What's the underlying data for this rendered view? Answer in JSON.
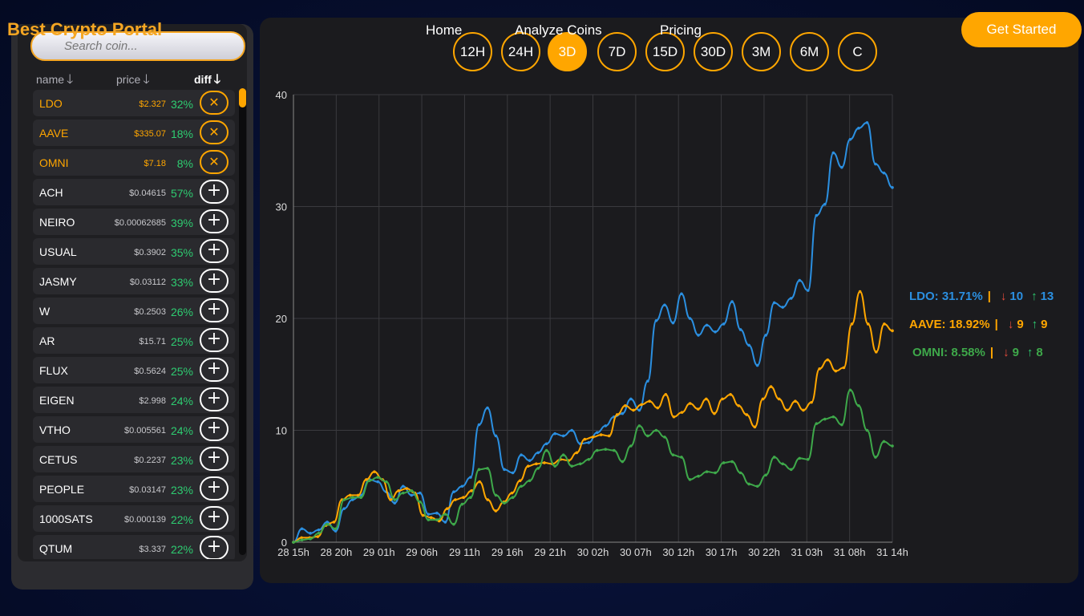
{
  "brand": "Best Crypto Portal",
  "nav": {
    "home": "Home",
    "analyze": "Analyze Coins",
    "pricing": "Pricing",
    "cta": "Get Started"
  },
  "search": {
    "placeholder": "Search coin..."
  },
  "columns": {
    "name": "name",
    "price": "price",
    "diff": "diff",
    "sort_icon": "arrow-down-icon"
  },
  "coins": [
    {
      "name": "LDO",
      "price": "$2.327",
      "diff": "32%",
      "selected": true
    },
    {
      "name": "AAVE",
      "price": "$335.07",
      "diff": "18%",
      "selected": true
    },
    {
      "name": "OMNI",
      "price": "$7.18",
      "diff": "8%",
      "selected": true
    },
    {
      "name": "ACH",
      "price": "$0.04615",
      "diff": "57%",
      "selected": false
    },
    {
      "name": "NEIRO",
      "price": "$0.00062685",
      "diff": "39%",
      "selected": false
    },
    {
      "name": "USUAL",
      "price": "$0.3902",
      "diff": "35%",
      "selected": false
    },
    {
      "name": "JASMY",
      "price": "$0.03112",
      "diff": "33%",
      "selected": false
    },
    {
      "name": "W",
      "price": "$0.2503",
      "diff": "26%",
      "selected": false
    },
    {
      "name": "AR",
      "price": "$15.71",
      "diff": "25%",
      "selected": false
    },
    {
      "name": "FLUX",
      "price": "$0.5624",
      "diff": "25%",
      "selected": false
    },
    {
      "name": "EIGEN",
      "price": "$2.998",
      "diff": "24%",
      "selected": false
    },
    {
      "name": "VTHO",
      "price": "$0.005561",
      "diff": "24%",
      "selected": false
    },
    {
      "name": "CETUS",
      "price": "$0.2237",
      "diff": "23%",
      "selected": false
    },
    {
      "name": "PEOPLE",
      "price": "$0.03147",
      "diff": "23%",
      "selected": false
    },
    {
      "name": "1000SATS",
      "price": "$0.000139",
      "diff": "22%",
      "selected": false
    },
    {
      "name": "QTUM",
      "price": "$3.337",
      "diff": "22%",
      "selected": false
    }
  ],
  "buttons": {
    "remove_icon": "close-icon",
    "remove_glyph": "✕",
    "add_icon": "plus-icon",
    "add_glyph": "+"
  },
  "timeframes": {
    "options": [
      "12H",
      "24H",
      "3D",
      "7D",
      "15D",
      "30D",
      "3M",
      "6M",
      "C"
    ],
    "active": "3D"
  },
  "chart_data": {
    "type": "line",
    "x_ticks": [
      "28 15h",
      "28 20h",
      "29 01h",
      "29 06h",
      "29 11h",
      "29 16h",
      "29 21h",
      "30 02h",
      "30 07h",
      "30 12h",
      "30 17h",
      "30 22h",
      "31 03h",
      "31 08h",
      "31 14h"
    ],
    "y_ticks": [
      0,
      10,
      20,
      30,
      40
    ],
    "ylim": [
      0,
      40
    ],
    "grid": true,
    "series": [
      {
        "name": "LDO",
        "color": "#2b8fe0",
        "values": [
          0,
          1.2,
          0.8,
          1.1,
          1.8,
          1.0,
          3.0,
          3.8,
          4.2,
          5.6,
          5.4,
          4.5,
          3.5,
          5.0,
          4.2,
          4.4,
          2.5,
          2.6,
          1.8,
          4.5,
          5.0,
          5.8,
          10.5,
          12.0,
          9.5,
          6.5,
          6.2,
          7.8,
          7.3,
          8.0,
          8.8,
          9.7,
          9.5,
          10.0,
          8.8,
          8.9,
          9.8,
          10.4,
          11.2,
          11.5,
          12.8,
          11.8,
          14.4,
          19.8,
          21.2,
          19.6,
          22.2,
          20.0,
          18.5,
          19.4,
          18.8,
          19.5,
          21.5,
          19.0,
          17.6,
          15.8,
          18.5,
          21.4,
          21.0,
          21.8,
          23.4,
          22.5,
          29.2,
          30.2,
          34.8,
          33.5,
          36.0,
          37.0,
          37.5,
          33.8,
          33.0,
          31.7
        ]
      },
      {
        "name": "AAVE",
        "color": "#ffa600",
        "values": [
          0,
          0.4,
          0.4,
          0.5,
          1.5,
          1.8,
          3.8,
          4.2,
          4.2,
          5.6,
          6.3,
          5.6,
          3.8,
          4.6,
          4.8,
          4.4,
          2.4,
          2.2,
          1.9,
          3.0,
          3.8,
          4.0,
          4.6,
          5.4,
          3.8,
          2.8,
          3.6,
          4.4,
          5.5,
          6.8,
          7.0,
          7.1,
          7.0,
          7.4,
          7.3,
          8.0,
          9.2,
          9.4,
          9.6,
          9.5,
          11.4,
          12.2,
          11.8,
          12.3,
          12.6,
          12.0,
          13.2,
          11.2,
          11.6,
          12.4,
          11.9,
          12.8,
          11.5,
          12.8,
          13.2,
          12.2,
          11.4,
          10.3,
          12.8,
          13.9,
          12.8,
          11.8,
          12.6,
          11.8,
          12.5,
          15.5,
          16.3,
          15.3,
          15.6,
          19.5,
          22.4,
          19.5,
          17.0,
          19.5,
          18.9
        ]
      },
      {
        "name": "OMNI",
        "color": "#3ea84a",
        "values": [
          0,
          0.2,
          0.3,
          0.8,
          1.6,
          1.2,
          3.8,
          4.0,
          4.0,
          5.5,
          5.8,
          5.4,
          3.8,
          4.4,
          4.6,
          3.6,
          2.0,
          2.0,
          2.5,
          1.6,
          3.4,
          4.0,
          6.5,
          6.6,
          4.2,
          3.5,
          4.0,
          5.0,
          5.5,
          6.6,
          8.2,
          6.8,
          7.8,
          6.8,
          7.0,
          7.4,
          8.2,
          8.3,
          8.2,
          7.2,
          8.6,
          10.4,
          9.5,
          10.0,
          9.4,
          7.8,
          7.6,
          5.6,
          5.9,
          6.3,
          6.2,
          7.1,
          7.2,
          6.2,
          5.2,
          5.0,
          6.0,
          7.6,
          7.0,
          6.5,
          7.5,
          7.4,
          10.6,
          11.0,
          11.2,
          10.5,
          13.6,
          12.2,
          10.0,
          7.6,
          9.0,
          8.6
        ]
      }
    ]
  },
  "legend": [
    {
      "label": "LDO: 31.71%",
      "color": "#2b8fe0",
      "down": "10",
      "up": "13"
    },
    {
      "label": "AAVE: 18.92%",
      "color": "#ffa600",
      "down": "9",
      "up": "9"
    },
    {
      "label": "OMNI: 8.58%",
      "color": "#3ea84a",
      "down": "9",
      "up": "8"
    }
  ],
  "legend_separator": "|",
  "legend_icons": {
    "down": "arrow-down-icon",
    "up": "arrow-up-icon",
    "down_glyph": "↓",
    "up_glyph": "↑"
  }
}
